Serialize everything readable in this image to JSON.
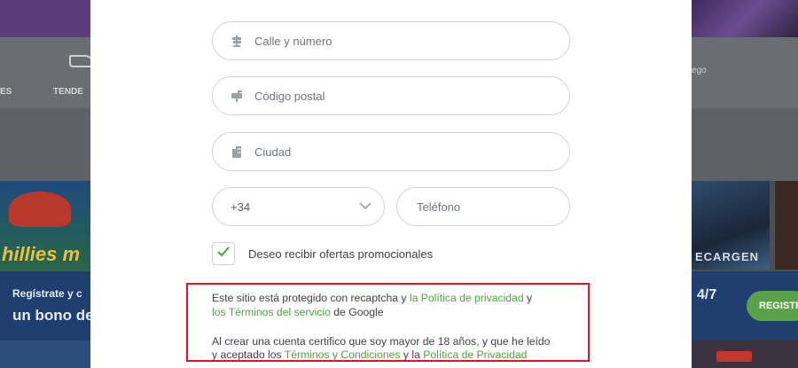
{
  "background": {
    "nav_items": [
      "ES",
      "TENDE"
    ],
    "search_hint": "ego",
    "game_left_title": "hillies m",
    "promo_left_line1": "Regístrate y c",
    "promo_left_line2": "un bono de",
    "game_right_title": "ECARGEN",
    "promo_right_text": "4/7",
    "promo_right_button": "REGISTR"
  },
  "form": {
    "street": {
      "placeholder": "Calle y número",
      "icon": "street-sign-icon"
    },
    "postal": {
      "placeholder": "Código postal",
      "icon": "mailbox-icon"
    },
    "city": {
      "placeholder": "Ciudad",
      "icon": "building-icon"
    },
    "phone": {
      "code": "+34",
      "placeholder": "Teléfono"
    },
    "promo_checkbox": {
      "label": "Deseo recibir ofertas promocionales",
      "checked": true
    }
  },
  "legal": {
    "recaptcha_prefix": "Este sitio está protegido con recaptcha y ",
    "privacy_link": "la Política de privacidad",
    "recaptcha_mid": " y",
    "terms_service_link": "los Términos del servicio",
    "recaptcha_suffix": " de Google",
    "age_line1": "Al crear una cuenta certifico que soy mayor de 18 años, y que he leído",
    "age_line2_prefix": "y aceptado los ",
    "terms_conditions_link": "Términos y Condiciones",
    "age_line2_mid": " y la ",
    "privacy_policy_link": "Política de Privacidad"
  },
  "colors": {
    "accent_green": "#4ba23f",
    "highlight_red": "#e3121b"
  }
}
